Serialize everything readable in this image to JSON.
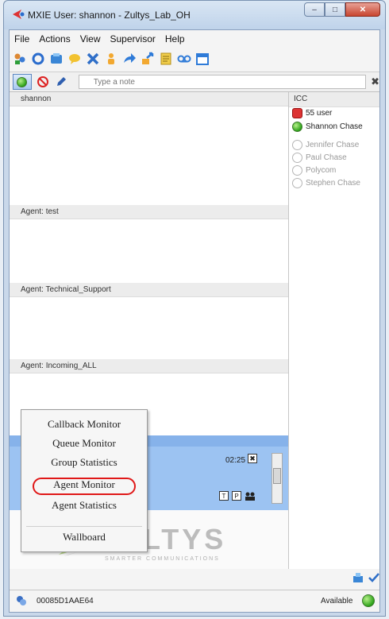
{
  "window": {
    "title": "MXIE User: shannon - Zultys_Lab_OH",
    "minimize": "–",
    "maximize": "□",
    "close": "✕"
  },
  "menubar": [
    "File",
    "Actions",
    "View",
    "Supervisor",
    "Help"
  ],
  "toolbar_icons": [
    "contacts-icon",
    "settings-icon",
    "phone-book-icon",
    "chat-icon",
    "delete-icon",
    "presence-icon",
    "forward-icon",
    "transfer-icon",
    "notes-icon",
    "voicemail-icon",
    "calendar-icon"
  ],
  "note": {
    "placeholder": "Type a note",
    "clear": "✖"
  },
  "main": {
    "sections": [
      {
        "label": "shannon"
      },
      {
        "label": "Agent: test"
      },
      {
        "label": "Agent: Technical_Support"
      },
      {
        "label": "Agent: Incoming_ALL"
      }
    ],
    "call": {
      "time": "02:25",
      "close": "✖"
    }
  },
  "context_menu": {
    "items": [
      "Callback Monitor",
      "Queue Monitor",
      "Group Statistics",
      "Agent Monitor",
      "Agent Statistics"
    ],
    "footer_item": "Wallboard",
    "highlighted": "Agent Monitor"
  },
  "logo": {
    "text": "ZULTYS",
    "sub": "SMARTER COMMUNICATIONS"
  },
  "side": {
    "header": "ICC",
    "contacts": [
      {
        "name": "55 user",
        "status": "busy"
      },
      {
        "name": "Shannon Chase",
        "status": "available"
      },
      {
        "name": "Jennifer Chase",
        "status": "offline"
      },
      {
        "name": "Paul Chase",
        "status": "offline"
      },
      {
        "name": "Polycom",
        "status": "offline"
      },
      {
        "name": "Stephen Chase",
        "status": "offline"
      }
    ]
  },
  "statusbar": {
    "device_id": "00085D1AAE64",
    "status": "Available"
  }
}
